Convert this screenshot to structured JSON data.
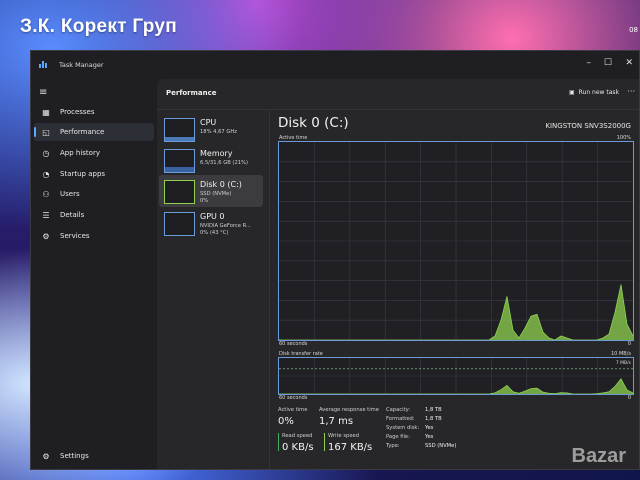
{
  "photo": {
    "overlay_text": "З.К. Корект Груп",
    "clock_fragment": "08",
    "watermark": "Bazar"
  },
  "window": {
    "title": "Task Manager",
    "controls": {
      "minimize": "–",
      "maximize": "☐",
      "close": "✕"
    }
  },
  "sidebar": {
    "menu_icon": "hamburger-icon",
    "items": [
      {
        "label": "Processes",
        "icon": "processes-grid-icon",
        "glyph": "▦"
      },
      {
        "label": "Performance",
        "icon": "performance-pulse-icon",
        "glyph": "◱",
        "active": true
      },
      {
        "label": "App history",
        "icon": "history-clock-icon",
        "glyph": "◷"
      },
      {
        "label": "Startup apps",
        "icon": "startup-gauge-icon",
        "glyph": "◔"
      },
      {
        "label": "Users",
        "icon": "users-icon",
        "glyph": "⚇"
      },
      {
        "label": "Details",
        "icon": "details-list-icon",
        "glyph": "☰"
      },
      {
        "label": "Services",
        "icon": "services-gear-icon",
        "glyph": "⚙"
      }
    ],
    "settings": {
      "label": "Settings",
      "icon": "gear-icon",
      "glyph": "⚙"
    }
  },
  "header": {
    "title": "Performance",
    "run_task": "Run new task",
    "more": "···"
  },
  "devices": [
    {
      "title": "CPU",
      "sub": [
        "18% 4,67 GHz"
      ],
      "fill": 0.18
    },
    {
      "title": "Memory",
      "sub": [
        "6,5/31,6 GB (21%)"
      ],
      "fill": 0.21
    },
    {
      "title": "Disk 0 (C:)",
      "sub": [
        "SSD (NVMe)",
        "0%"
      ],
      "fill": 0.02,
      "active": true
    },
    {
      "title": "GPU 0",
      "sub": [
        "NVIDIA GeForce R...",
        "0% (43 °C)"
      ],
      "fill": 0.0
    }
  ],
  "detail": {
    "title": "Disk 0 (C:)",
    "model": "KINGSTON SNV3S2000G",
    "graph1": {
      "label_left": "Active time",
      "label_right": "100%",
      "footer_left": "60 seconds",
      "footer_right": "0"
    },
    "graph2": {
      "label_left": "Disk transfer rate",
      "label_right": "10 MB/s",
      "marker": "7 MB/s",
      "footer_left": "60 seconds",
      "footer_right": "0"
    },
    "stats": {
      "active_time": {
        "label": "Active time",
        "value": "0%"
      },
      "avg_response": {
        "label": "Average response time",
        "value": "1,7 ms"
      },
      "read_speed": {
        "label": "Read speed",
        "value": "0 KB/s"
      },
      "write_speed": {
        "label": "Write speed",
        "value": "167 KB/s"
      }
    },
    "properties": [
      {
        "key": "Capacity:",
        "value": "1,8 TB"
      },
      {
        "key": "Formatted:",
        "value": "1,8 TB"
      },
      {
        "key": "System disk:",
        "value": "Yes"
      },
      {
        "key": "Page file:",
        "value": "Yes"
      },
      {
        "key": "Type:",
        "value": "SSD (NVMe)"
      }
    ]
  },
  "colors": {
    "accent": "#5aa9ff",
    "graph_border": "#6a9ad8",
    "disk_green": "#8fd14f",
    "read_bar": "#3fae5e",
    "write_bar": "#8fd14f"
  },
  "activity_series": {
    "active_time_pct": [
      0,
      0,
      0,
      0,
      0,
      0,
      0,
      0,
      0,
      0,
      0,
      0,
      0,
      0,
      0,
      0,
      0,
      0,
      0,
      0,
      0,
      0,
      0,
      0,
      0,
      0,
      0,
      0,
      0,
      0,
      0,
      0,
      0,
      0,
      0,
      0,
      2,
      10,
      22,
      5,
      1,
      6,
      12,
      13,
      4,
      1,
      0,
      2,
      1,
      0,
      0,
      0,
      0,
      0,
      1,
      3,
      14,
      28,
      8,
      2
    ],
    "transfer_mbps": [
      0,
      0,
      0,
      0,
      0,
      0,
      0,
      0,
      0,
      0,
      0,
      0,
      0,
      0,
      0,
      0,
      0,
      0,
      0,
      0,
      0,
      0,
      0,
      0,
      0,
      0,
      0,
      0,
      0,
      0,
      0,
      0,
      0,
      0,
      0,
      0,
      0.3,
      1.2,
      2.4,
      0.6,
      0.2,
      0.8,
      1.5,
      1.6,
      0.5,
      0.2,
      0.1,
      0.4,
      0.3,
      0,
      0,
      0,
      0,
      0.1,
      0.3,
      0.6,
      2.1,
      4.2,
      1.1,
      0.3
    ]
  }
}
